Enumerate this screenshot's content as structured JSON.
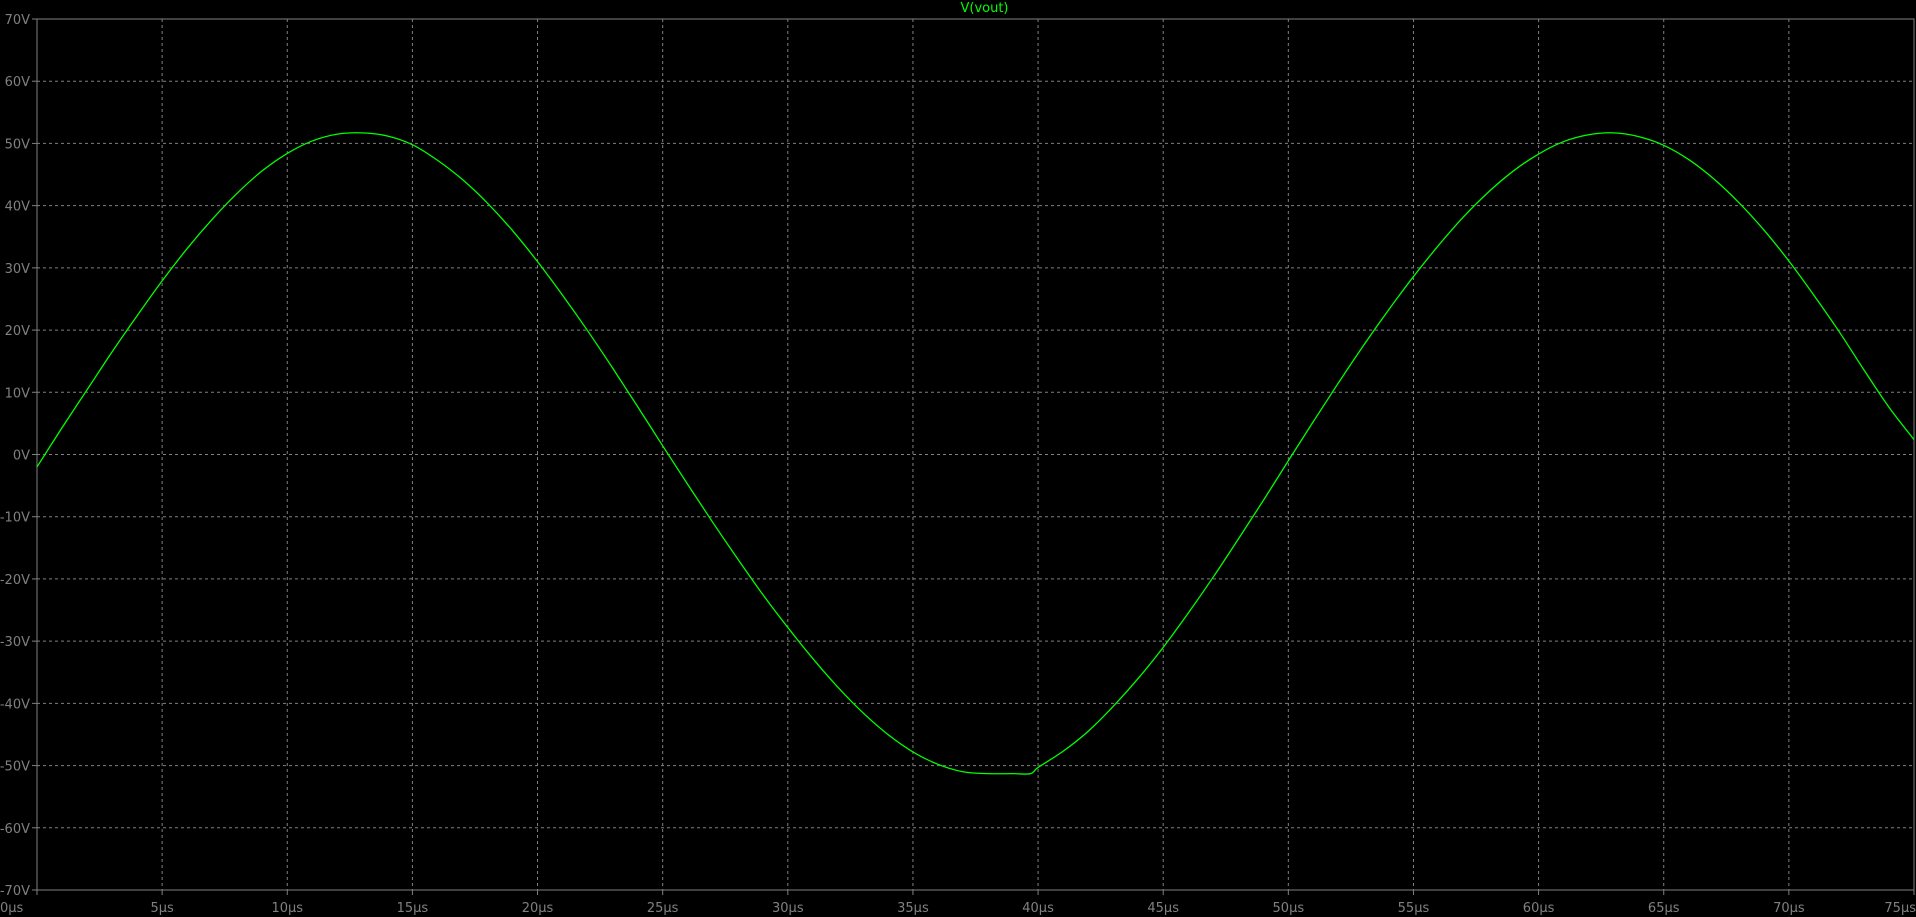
{
  "colors": {
    "background": "#000000",
    "axis_text": "#808080",
    "grid": "#808080",
    "frame": "#808080",
    "trace": "#00ff00",
    "title": "#00ff00"
  },
  "chart_data": {
    "type": "line",
    "title": "V(vout)",
    "xlabel": "",
    "ylabel": "",
    "xlim": [
      0,
      75
    ],
    "ylim": [
      -70,
      70
    ],
    "grid": true,
    "grid_style": "dashed",
    "x_ticks": [
      0,
      5,
      10,
      15,
      20,
      25,
      30,
      35,
      40,
      45,
      50,
      55,
      60,
      65,
      70,
      75
    ],
    "x_tick_labels": [
      "0µs",
      "5µs",
      "10µs",
      "15µs",
      "20µs",
      "25µs",
      "30µs",
      "35µs",
      "40µs",
      "45µs",
      "50µs",
      "55µs",
      "60µs",
      "65µs",
      "70µs",
      "75µs"
    ],
    "y_ticks": [
      70,
      60,
      50,
      40,
      30,
      20,
      10,
      0,
      -10,
      -20,
      -30,
      -40,
      -50,
      -60,
      -70
    ],
    "y_tick_labels": [
      "70V",
      "60V",
      "50V",
      "40V",
      "30V",
      "20V",
      "10V",
      "0V",
      "-10V",
      "-20V",
      "-30V",
      "-40V",
      "-50V",
      "-60V",
      "-70V"
    ],
    "series": [
      {
        "name": "V(vout)",
        "x": [
          0,
          1,
          2,
          3,
          4,
          5,
          6,
          7,
          8,
          9,
          10,
          11,
          12,
          13,
          14,
          15,
          16,
          17,
          18,
          19,
          20,
          21,
          22,
          23,
          24,
          25,
          26,
          27,
          28,
          29,
          30,
          31,
          32,
          33,
          34,
          35,
          36,
          37,
          38,
          39,
          39.7,
          40,
          41,
          42,
          43,
          44,
          45,
          46,
          47,
          48,
          49,
          50,
          51,
          52,
          53,
          54,
          55,
          56,
          57,
          58,
          59,
          60,
          61,
          62,
          63,
          64,
          65,
          66,
          67,
          68,
          69,
          70,
          71,
          72,
          73,
          74,
          75
        ],
        "y": [
          -2,
          4.3,
          10.4,
          16.5,
          22.3,
          27.9,
          33.1,
          37.8,
          42,
          45.6,
          48.4,
          50.4,
          51.5,
          51.7,
          51.2,
          49.8,
          47.3,
          44.2,
          40.4,
          36,
          31,
          25.6,
          19.9,
          13.9,
          7.7,
          1.4,
          -4.8,
          -10.9,
          -16.8,
          -22.5,
          -27.8,
          -32.8,
          -37.4,
          -41.5,
          -45,
          -47.8,
          -49.8,
          -51,
          -51.3,
          -51.3,
          -51.3,
          -50.3,
          -47.7,
          -44.5,
          -40.5,
          -36,
          -31,
          -25.5,
          -19.7,
          -13.6,
          -7.4,
          -1,
          5.3,
          11.5,
          17.5,
          23.2,
          28.6,
          33.6,
          38.2,
          42.2,
          45.6,
          48.3,
          50.3,
          51.4,
          51.7,
          51.1,
          49.7,
          47.4,
          44.3,
          40.5,
          36.1,
          31.1,
          25.6,
          19.8,
          13.6,
          7.6,
          2.4
        ]
      }
    ]
  }
}
